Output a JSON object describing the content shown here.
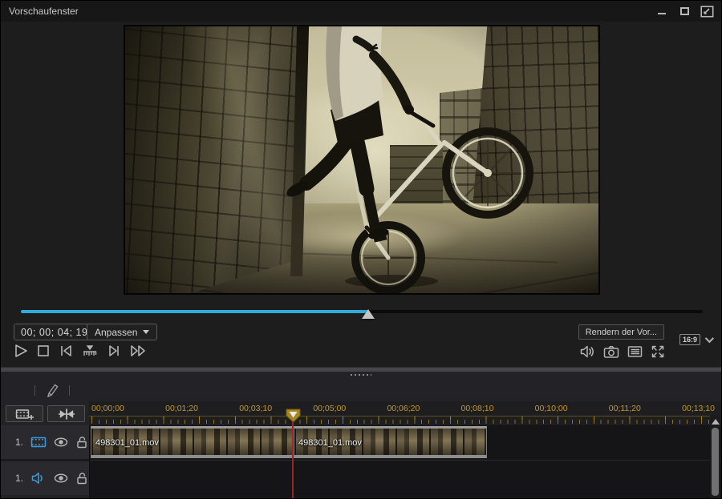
{
  "window": {
    "title": "Vorschaufenster"
  },
  "preview": {
    "timecode": "00; 00; 04; 19",
    "fit_label": "Anpassen",
    "render_label": "Rendern der Vor...",
    "aspect_label": "16:9",
    "seek_position_pct": 51
  },
  "timeline": {
    "ruler_labels": [
      "00;00;00",
      "00;01;20",
      "00;03;10",
      "00;05;00",
      "00;06;20",
      "00;08;10",
      "00;10;00",
      "00;11;20",
      "00;13;10"
    ],
    "tracks": [
      {
        "number": "1.",
        "type": "video"
      },
      {
        "number": "1.",
        "type": "audio"
      }
    ],
    "clips": [
      {
        "label": "498301_01.mov"
      },
      {
        "label": "498301_01.mov"
      }
    ]
  },
  "icons": {
    "titlebar": [
      "minimize-icon",
      "maximize-icon",
      "undock-icon"
    ],
    "transport": [
      "play-icon",
      "stop-icon",
      "previous-frame-icon",
      "seek-snap-icon",
      "next-frame-icon",
      "fast-forward-icon"
    ],
    "preview_tools": [
      "speaker-icon",
      "snapshot-camera-icon",
      "details-icon",
      "fullscreen-icon"
    ],
    "timeline_tools": [
      "marker-pen-icon",
      "add-track-icon",
      "split-clip-icon"
    ],
    "track_row": [
      "video-track-icon",
      "audio-track-icon",
      "eye-icon",
      "lock-open-icon"
    ]
  },
  "colors": {
    "seekbar_fill": "#35a9da",
    "ruler_gold": "#c49a2a",
    "playhead_red": "#9c2427",
    "track_icon_blue": "#3f9bd8",
    "clip_border_gray": "#9a9a9a"
  }
}
